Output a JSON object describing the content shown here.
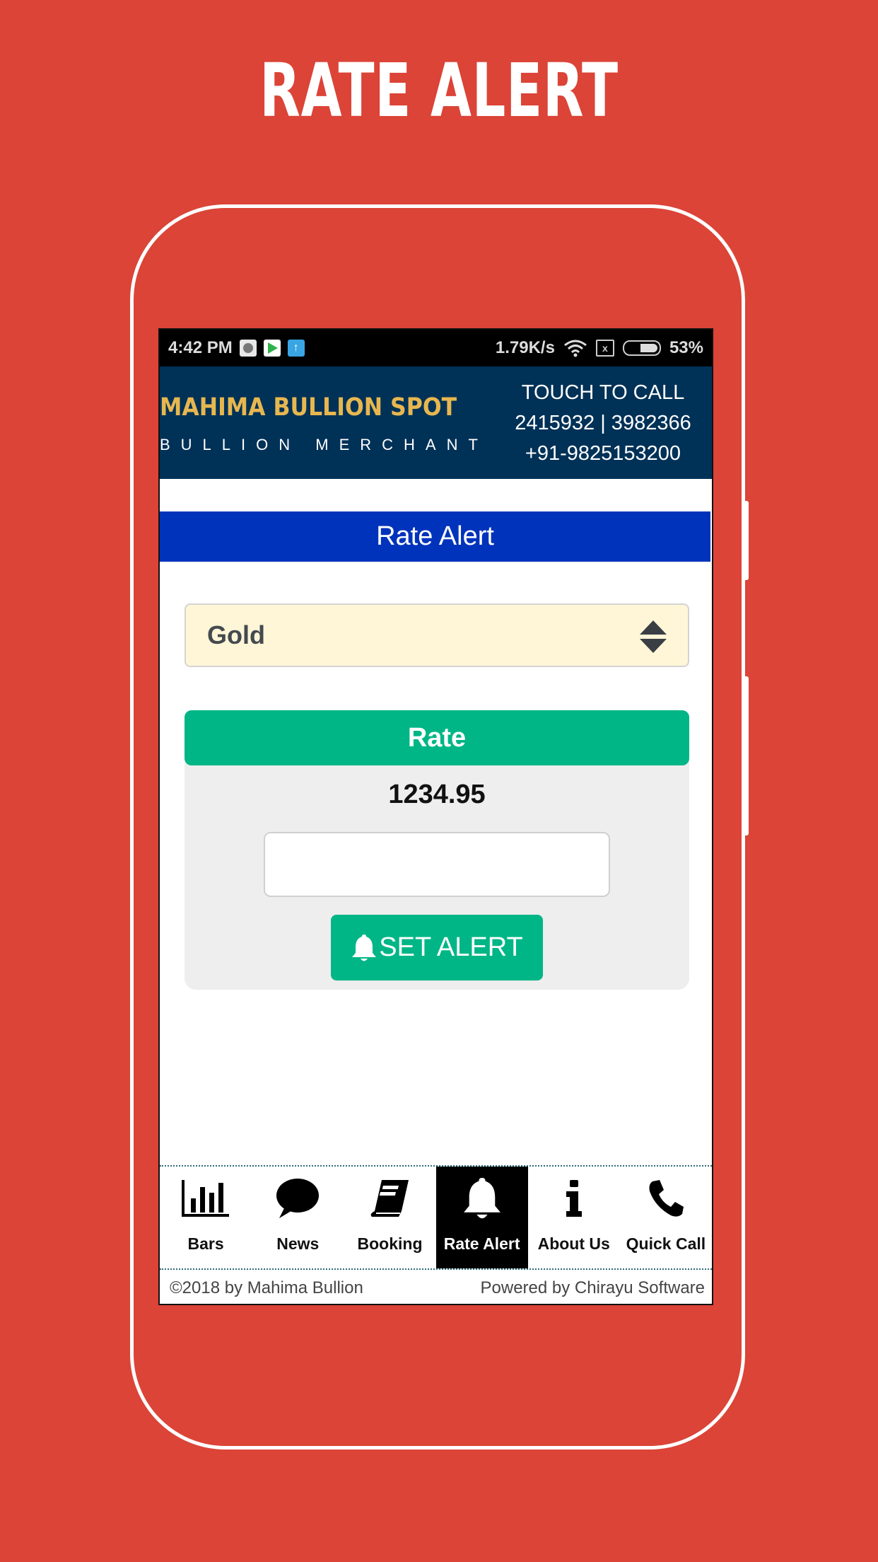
{
  "promo": {
    "title": "RATE ALERT"
  },
  "status_bar": {
    "time": "4:42 PM",
    "notification_icons": [
      "shield-app-icon",
      "play-store-icon",
      "upload-icon"
    ],
    "network_speed": "1.79K/s",
    "wifi_icon": "wifi-icon",
    "sim_icon": "no-sim-icon",
    "battery_percent": "53%"
  },
  "header": {
    "brand_name": "MAHIMA BULLION SPOT",
    "brand_tagline": "BULLION MERCHANT",
    "call_label": "TOUCH TO CALL",
    "phone_landlines": "2415932 | 3982366",
    "phone_mobile": "+91-9825153200",
    "brand_color": "#e7b74f",
    "background_color": "#003157"
  },
  "page": {
    "banner_title": "Rate Alert",
    "banner_color": "#0033bb"
  },
  "form": {
    "metal_select": {
      "selected": "Gold"
    },
    "rate_label": "Rate",
    "rate_value": "1234.95",
    "alert_input": {
      "value": "",
      "placeholder": ""
    },
    "set_alert_label": "SET ALERT",
    "accent_color": "#00b686"
  },
  "bottom_nav": {
    "items": [
      {
        "label": "Bars",
        "icon": "bar-chart-icon",
        "active": false
      },
      {
        "label": "News",
        "icon": "speech-bubble-icon",
        "active": false
      },
      {
        "label": "Booking",
        "icon": "book-icon",
        "active": false
      },
      {
        "label": "Rate Alert",
        "icon": "bell-icon",
        "active": true
      },
      {
        "label": "About Us",
        "icon": "info-icon",
        "active": false
      },
      {
        "label": "Quick Call",
        "icon": "phone-icon",
        "active": false
      }
    ]
  },
  "footer": {
    "copyright": "©2018 by Mahima Bullion",
    "powered_by": "Powered by Chirayu Software"
  }
}
